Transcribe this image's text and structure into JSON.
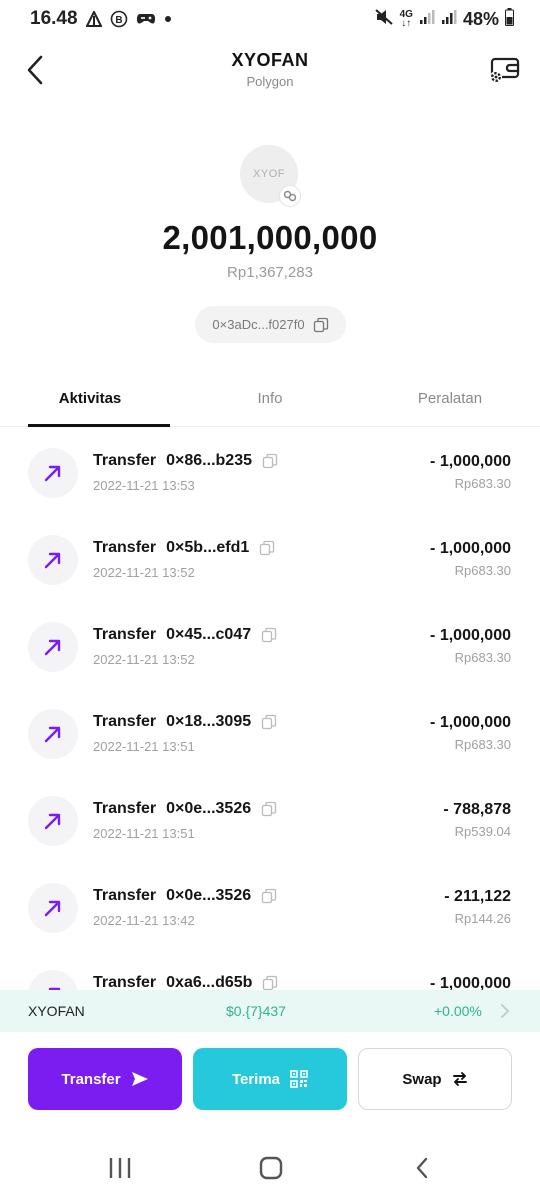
{
  "status_bar": {
    "time": "16.48",
    "network": "4G",
    "battery": "48%"
  },
  "header": {
    "title": "XYOFAN",
    "subtitle": "Polygon"
  },
  "token": {
    "logo_text": "XYOF",
    "balance": "2,001,000,000",
    "fiat_value": "Rp1,367,283",
    "address": "0×3aDc...f027f0"
  },
  "tabs": [
    {
      "label": "Aktivitas",
      "active": true
    },
    {
      "label": "Info",
      "active": false
    },
    {
      "label": "Peralatan",
      "active": false
    }
  ],
  "transactions": [
    {
      "type": "Transfer",
      "address": "0×86...b235",
      "time": "2022-11-21 13:53",
      "amount": "- 1,000,000",
      "fiat": "Rp683.30"
    },
    {
      "type": "Transfer",
      "address": "0×5b...efd1",
      "time": "2022-11-21 13:52",
      "amount": "- 1,000,000",
      "fiat": "Rp683.30"
    },
    {
      "type": "Transfer",
      "address": "0×45...c047",
      "time": "2022-11-21 13:52",
      "amount": "- 1,000,000",
      "fiat": "Rp683.30"
    },
    {
      "type": "Transfer",
      "address": "0×18...3095",
      "time": "2022-11-21 13:51",
      "amount": "- 1,000,000",
      "fiat": "Rp683.30"
    },
    {
      "type": "Transfer",
      "address": "0×0e...3526",
      "time": "2022-11-21 13:51",
      "amount": "- 788,878",
      "fiat": "Rp539.04"
    },
    {
      "type": "Transfer",
      "address": "0×0e...3526",
      "time": "2022-11-21 13:42",
      "amount": "- 211,122",
      "fiat": "Rp144.26"
    },
    {
      "type": "Transfer",
      "address": "0xa6...d65b",
      "time": "",
      "amount": "- 1,000,000",
      "fiat": ""
    }
  ],
  "price_bar": {
    "symbol": "XYOFAN",
    "price": "$0.{7}437",
    "change": "+0.00%"
  },
  "actions": {
    "transfer": "Transfer",
    "receive": "Terima",
    "swap": "Swap"
  },
  "colors": {
    "accent_purple": "#7b1cf0",
    "accent_cyan": "#26c9dc",
    "positive_green": "#2bb58f",
    "price_bar_bg": "#e9f8f4"
  },
  "icons": {
    "back": "back-chevron-icon",
    "settings": "token-settings-icon",
    "copy": "copy-icon",
    "outgoing": "arrow-up-right-icon",
    "send": "send-icon",
    "qr": "qr-code-icon",
    "swap": "swap-arrows-icon"
  }
}
